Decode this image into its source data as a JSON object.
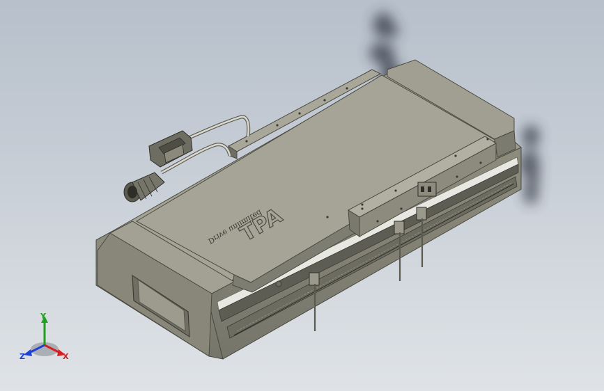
{
  "viewport": {
    "background_top": "#b7c0cb",
    "background_bottom": "#dfe3e7"
  },
  "model": {
    "body_color": "#8f8e7f",
    "top_color": "#a4a394",
    "dark_color": "#5a5a50",
    "rail_color": "#e8e8e2",
    "engraving": {
      "logo": "TPA",
      "text": "Drive unlimited"
    }
  },
  "triad": {
    "x_label": "X",
    "y_label": "Y",
    "z_label": "Z",
    "x_color": "#d42020",
    "y_color": "#20a020",
    "z_color": "#2040d0"
  }
}
